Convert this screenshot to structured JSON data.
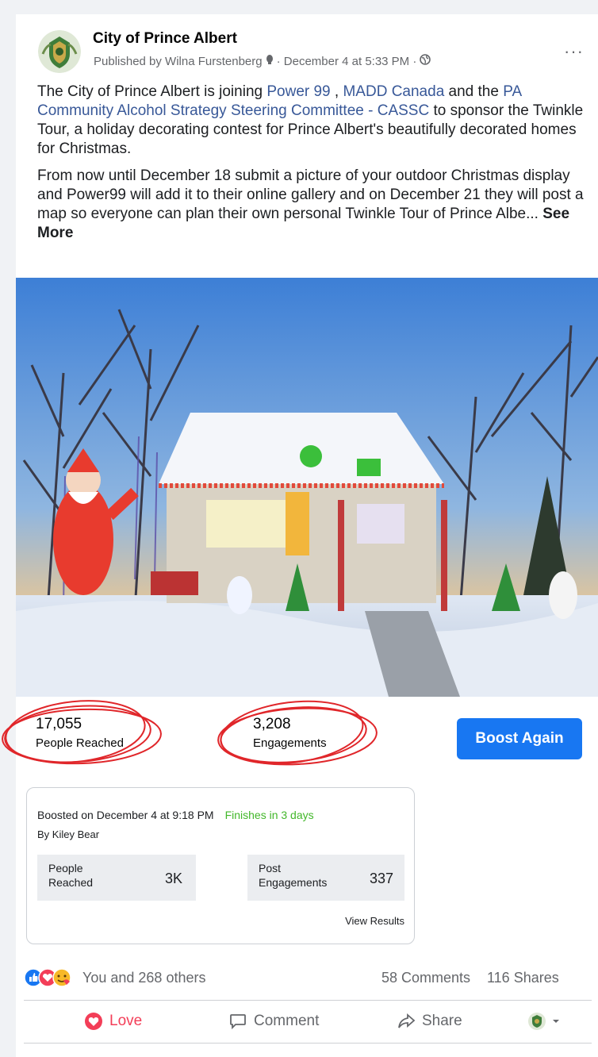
{
  "post": {
    "page_name": "City of Prince Albert",
    "published_by": "Published by Wilna Furstenberg",
    "date": "· December 4 at 5:33 PM ·",
    "more_label": "···",
    "p1_a": "The City of Prince Albert is joining ",
    "link_power99": "Power 99",
    "p1_b": " , ",
    "link_madd": "MADD Canada",
    "p1_c": " and the ",
    "link_cassc": "PA Community Alcohol Strategy Steering Committee - CASSC",
    "p1_d": " to sponsor the Twinkle Tour, a holiday decorating contest for Prince Albert's beautifully decorated homes for Christmas.",
    "p2": "From now until December 18 submit a picture of your outdoor Christmas display and Power99 will add it to their online gallery and on December 21 they will post a map so everyone can plan their own personal Twinkle Tour of Prince Albe... ",
    "see_more": "See More"
  },
  "insights": {
    "people_reached_value": "17,055",
    "people_reached_label": "People Reached",
    "engagements_value": "3,208",
    "engagements_label": "Engagements",
    "boost_again": "Boost Again"
  },
  "boost": {
    "boosted_on": "Boosted on December 4 at 9:18 PM",
    "finishes": "Finishes in 3 days",
    "by": "By Kiley Bear",
    "reached_label_1": "People",
    "reached_label_2": "Reached",
    "reached_value": "3K",
    "eng_label_1": "Post",
    "eng_label_2": "Engagements",
    "eng_value": "337",
    "view_results": "View Results"
  },
  "reactions": {
    "text": "You and 268 others",
    "comments": "58 Comments",
    "shares": "116 Shares"
  },
  "actions": {
    "love": "Love",
    "comment": "Comment",
    "share": "Share"
  },
  "colors": {
    "brand_blue": "#1877f2",
    "link": "#385898",
    "love_red": "#f33e58",
    "finishes_green": "#42b72a"
  }
}
